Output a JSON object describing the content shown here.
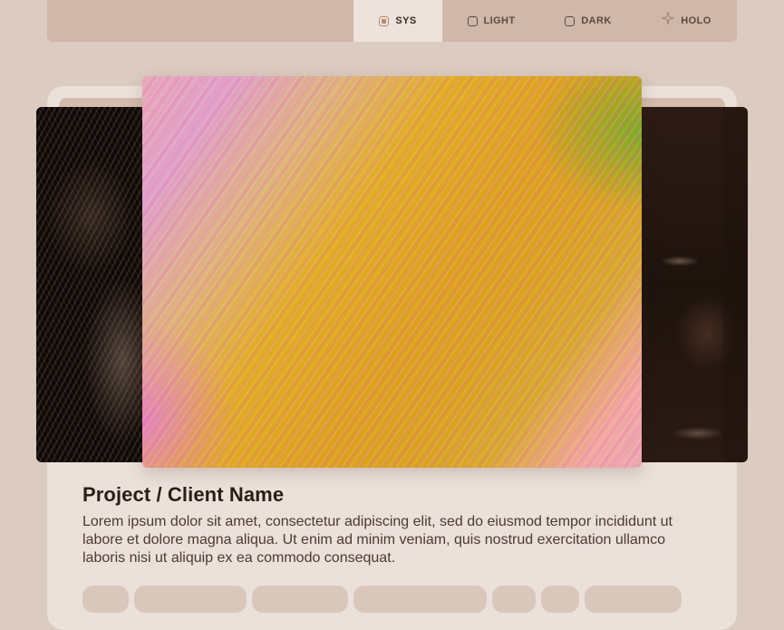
{
  "theme_switcher": {
    "options": [
      {
        "label": "SYS",
        "icon": "radio-selected-icon",
        "active": true
      },
      {
        "label": "LIGHT",
        "icon": "radio-icon",
        "active": false
      },
      {
        "label": "DARK",
        "icon": "radio-icon",
        "active": false
      },
      {
        "label": "HOLO",
        "icon": "sparkle-icon",
        "active": false
      }
    ]
  },
  "project": {
    "title": "Project / Client Name",
    "description": "Lorem ipsum dolor sit amet, consectetur adipiscing elit, sed do eiusmod tempor incididunt ut labore et dolore magna aliqua. Ut enim ad minim veniam, quis nostrud exercitation ullamco laboris nisi ut aliquip ex ea commodo consequat."
  },
  "carousel": {
    "slides": [
      {
        "position": "previous",
        "image": "dark textured fabric"
      },
      {
        "position": "current",
        "image": "colorful abstract brush strokes"
      },
      {
        "position": "next",
        "image": "dark brown crumpled texture"
      }
    ]
  },
  "colors": {
    "page_background": "#dccbc0",
    "theme_bar": "#cfb7a9",
    "active_option": "#ede2dc",
    "card_background": "#ebe0da",
    "tag_background": "#dac7bc",
    "text_primary": "#2a1d17"
  }
}
